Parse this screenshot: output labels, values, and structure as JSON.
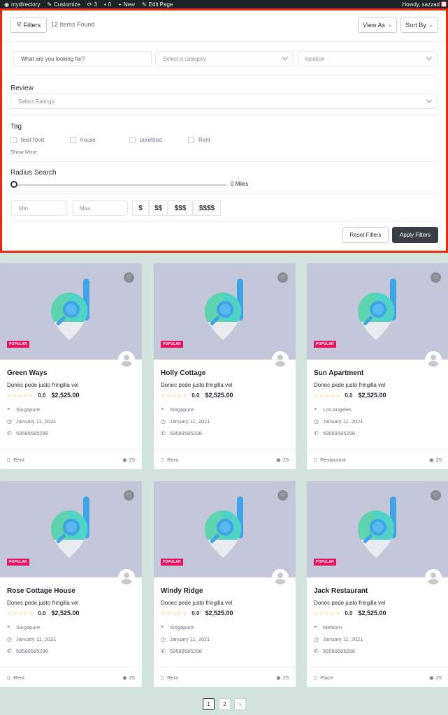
{
  "adminbar": {
    "site": "mydirectory",
    "customize": "Customize",
    "updates": "3",
    "comments": "0",
    "new": "New",
    "edit": "Edit Page",
    "howdy": "Howdy, sazzad"
  },
  "filters": {
    "filters_label": "Filters",
    "items_found": "12 Items Found",
    "view_as": "View As",
    "sort_by": "Sort By",
    "search_placeholder": "What are you looking for?",
    "category_placeholder": "Select a category",
    "location_placeholder": "location",
    "review_label": "Review",
    "ratings_placeholder": "Select Ratings",
    "tag_label": "Tag",
    "tags": [
      "best food",
      "house",
      "purefood",
      "Rent"
    ],
    "show_more": "Show More",
    "radius_label": "Radius Search",
    "radius_value": "0 Miles",
    "min_placeholder": "Min",
    "max_placeholder": "Max",
    "price_levels": [
      "$",
      "$$",
      "$$$",
      "$$$$"
    ],
    "reset": "Reset Filters",
    "apply": "Apply Filters"
  },
  "listings": [
    {
      "title": "Green Ways",
      "subtitle": "Donec pede justo fringilla vel",
      "rating": "0.0",
      "price": "$2,525.00",
      "location": "Singapure",
      "date": "January 11, 2021",
      "phone": "59589585298",
      "category": "Rent",
      "views": "25",
      "badge": "POPULAR"
    },
    {
      "title": "Holly Cottage",
      "subtitle": "Donec pede justo fringilla vel",
      "rating": "0.0",
      "price": "$2,525.00",
      "location": "Singapure",
      "date": "January 11, 2021",
      "phone": "59589585298",
      "category": "Rent",
      "views": "25",
      "badge": "POPULAR"
    },
    {
      "title": "Sun Apartment",
      "subtitle": "Donec pede justo fringilla vel",
      "rating": "0.0",
      "price": "$2,525.00",
      "location": "Los Angeles",
      "date": "January 11, 2021",
      "phone": "59589585298",
      "category": "Restaurant",
      "views": "25",
      "badge": "POPULAR"
    },
    {
      "title": "Rose Cottage House",
      "subtitle": "Donec pede justo fringilla vel",
      "rating": "0.0",
      "price": "$2,525.00",
      "location": "Singapure",
      "date": "January 11, 2021",
      "phone": "59589585298",
      "category": "Rent",
      "views": "25",
      "badge": "POPULAR"
    },
    {
      "title": "Windy Ridge",
      "subtitle": "Donec pede justo fringilla vel",
      "rating": "0.0",
      "price": "$2,525.00",
      "location": "Singapure",
      "date": "January 11, 2021",
      "phone": "59589585298",
      "category": "Rent",
      "views": "25",
      "badge": "POPULAR"
    },
    {
      "title": "Jack Restaurant",
      "subtitle": "Donec pede justo fringilla vel",
      "rating": "0.0",
      "price": "$2,525.00",
      "location": "Melborn",
      "date": "January 11, 2021",
      "phone": "59589585298",
      "category": "Place",
      "views": "25",
      "badge": "POPULAR"
    }
  ],
  "pagination": {
    "pages": [
      "1",
      "2"
    ],
    "next": "›",
    "current": "1"
  },
  "colors": {
    "accent": "#e8290b",
    "badge": "#e4125f",
    "apply_bg": "#3a3f47",
    "page_bg": "#d2e3dd",
    "star": "#f2a33a"
  }
}
